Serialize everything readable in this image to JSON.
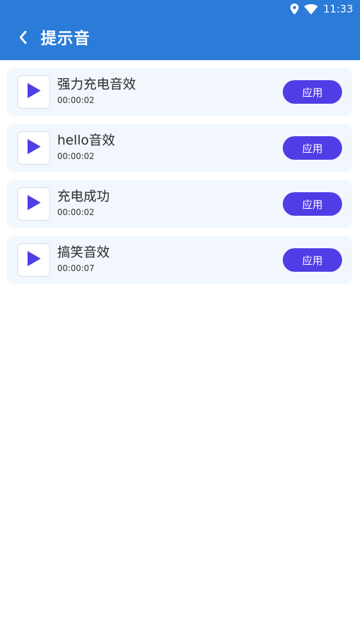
{
  "status_bar": {
    "time": "11:33",
    "icons": [
      "location-icon",
      "wifi-icon"
    ]
  },
  "header": {
    "title": "提示音",
    "back_icon": "chevron-left-icon",
    "background_color": "#2b7bd9"
  },
  "colors": {
    "accent": "#4f3de6",
    "card_background": "#f2f6fd"
  },
  "items": [
    {
      "name": "强力充电音效",
      "duration": "00:00:02",
      "action_label": "应用",
      "icon": "play-icon"
    },
    {
      "name": "hello音效",
      "duration": "00:00:02",
      "action_label": "应用",
      "icon": "play-icon"
    },
    {
      "name": "充电成功",
      "duration": "00:00:02",
      "action_label": "应用",
      "icon": "play-icon"
    },
    {
      "name": "搞笑音效",
      "duration": "00:00:07",
      "action_label": "应用",
      "icon": "play-icon"
    }
  ]
}
